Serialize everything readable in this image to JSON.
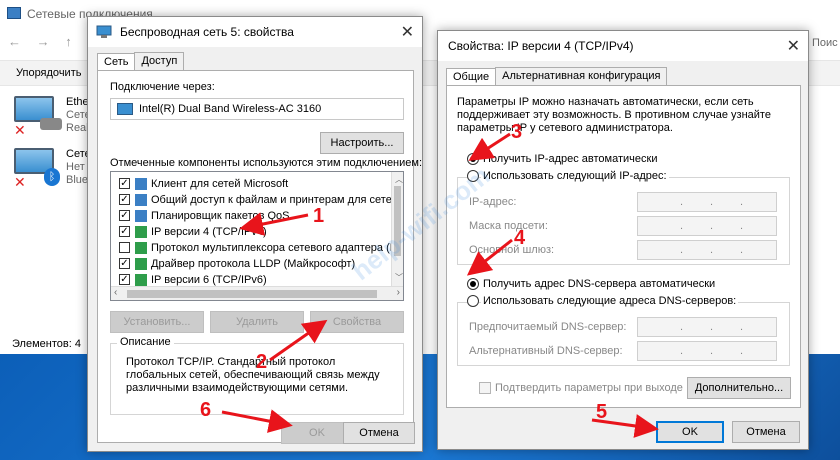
{
  "explorer": {
    "title": "Сетевые подключения",
    "toolbar_organize": "Упорядочить",
    "search_stub": "Поис",
    "connections": [
      {
        "name": "Ether",
        "line2": "Сете",
        "line3": "Realt"
      },
      {
        "name": "Сете",
        "line2": "Нет с",
        "line3": "Bluet"
      }
    ],
    "items_count": "Элементов: 4"
  },
  "wireless_dialog": {
    "title": "Беспроводная сеть 5: свойства",
    "tabs": [
      "Сеть",
      "Доступ"
    ],
    "connect_using_label": "Подключение через:",
    "adapter": "Intel(R) Dual Band Wireless-AC 3160",
    "configure_button": "Настроить...",
    "components_label": "Отмеченные компоненты используются этим подключением:",
    "components": [
      {
        "checked": true,
        "label": "Клиент для сетей Microsoft",
        "icon": "network-client-icon",
        "icon_color": "#3b7fc4"
      },
      {
        "checked": true,
        "label": "Общий доступ к файлам и принтерам для сетей Mi",
        "icon": "file-sharing-icon",
        "icon_color": "#3b7fc4"
      },
      {
        "checked": true,
        "label": "Планировщик пакетов QoS",
        "icon": "qos-icon",
        "icon_color": "#3b7fc4"
      },
      {
        "checked": true,
        "label": "IP версии 4 (TCP/IPv4)",
        "icon": "protocol-icon",
        "icon_color": "#2e9d4a"
      },
      {
        "checked": false,
        "label": "Протокол мультиплексора сетевого адаптера (Ма",
        "icon": "protocol-icon",
        "icon_color": "#2e9d4a"
      },
      {
        "checked": true,
        "label": "Драйвер протокола LLDP (Майкрософт)",
        "icon": "protocol-icon",
        "icon_color": "#2e9d4a"
      },
      {
        "checked": true,
        "label": "IP версии 6 (TCP/IPv6)",
        "icon": "protocol-icon",
        "icon_color": "#2e9d4a"
      }
    ],
    "install_button": "Установить...",
    "remove_button": "Удалить",
    "properties_button": "Свойства",
    "description_legend": "Описание",
    "description_text": "Протокол TCP/IP. Стандартный протокол глобальных сетей, обеспечивающий связь между различными взаимодействующими сетями.",
    "ok_button": "OK",
    "cancel_button": "Отмена"
  },
  "ipv4_dialog": {
    "title": "Свойства: IP версии 4 (TCP/IPv4)",
    "tabs": [
      "Общие",
      "Альтернативная конфигурация"
    ],
    "intro": "Параметры IP можно назначать автоматически, если сеть поддерживает эту возможность. В противном случае узнайте параметры IP у сетевого администратора.",
    "ip_auto": "Получить IP-адрес автоматически",
    "ip_manual": "Использовать следующий IP-адрес:",
    "ip_address_label": "IP-адрес:",
    "subnet_label": "Маска подсети:",
    "gateway_label": "Основной шлюз:",
    "dns_auto": "Получить адрес DNS-сервера автоматически",
    "dns_manual": "Использовать следующие адреса DNS-серверов:",
    "preferred_dns_label": "Предпочитаемый DNS-сервер:",
    "alternate_dns_label": "Альтернативный DNS-сервер:",
    "validate_label": "Подтвердить параметры при выходе",
    "advanced_button": "Дополнительно...",
    "ok_button": "OK",
    "cancel_button": "Отмена"
  },
  "annotations": {
    "steps": [
      "1",
      "2",
      "3",
      "4",
      "5",
      "6"
    ],
    "color": "#e8141b",
    "watermark": "help-wifi.com"
  }
}
